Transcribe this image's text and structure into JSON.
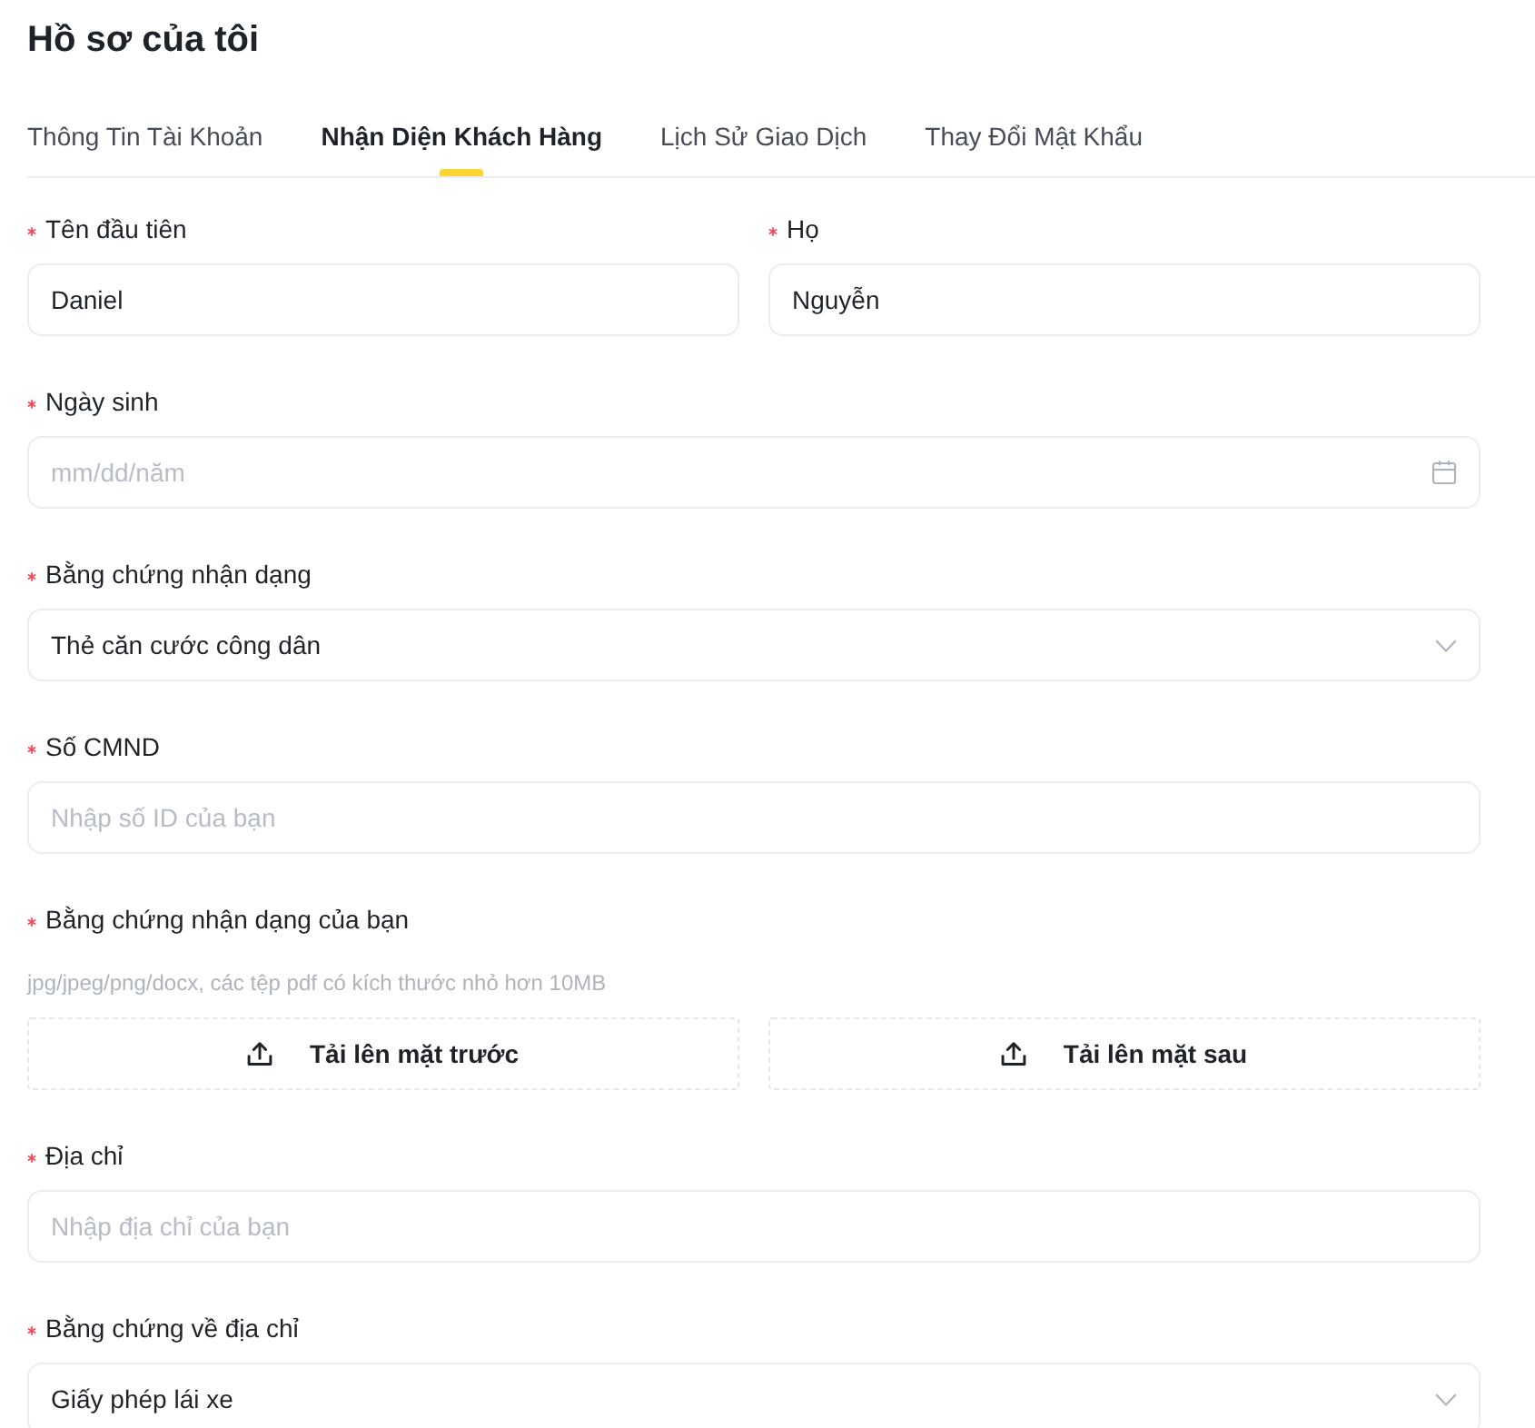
{
  "page": {
    "title": "Hồ sơ của tôi"
  },
  "tabs": [
    {
      "label": "Thông Tin Tài Khoản",
      "selected": false
    },
    {
      "label": "Nhận Diện Khách Hàng",
      "selected": true
    },
    {
      "label": "Lịch Sử Giao Dịch",
      "selected": false
    },
    {
      "label": "Thay Đổi Mật Khẩu",
      "selected": false
    }
  ],
  "form_rows": [
    {
      "fields": [
        {
          "kind": "text",
          "label": "Tên đầu tiên",
          "required": true,
          "value": "Daniel"
        },
        {
          "kind": "text",
          "label": "Họ",
          "required": true,
          "value": "Nguyễn"
        }
      ]
    },
    {
      "fields": [
        {
          "kind": "date",
          "label": "Ngày sinh",
          "required": true,
          "placeholder": "mm/dd/năm"
        }
      ]
    },
    {
      "fields": [
        {
          "kind": "select",
          "label": "Bằng chứng nhận dạng",
          "required": true,
          "value": "Thẻ căn cước công dân"
        }
      ]
    },
    {
      "fields": [
        {
          "kind": "text",
          "label": "Số CMND",
          "required": true,
          "placeholder": "Nhập số ID của bạn"
        }
      ]
    },
    {
      "fields": [
        {
          "kind": "upload",
          "label": "Bằng chứng nhận dạng của bạn",
          "required": true,
          "hint": "jpg/jpeg/png/docx, các tệp pdf có kích thước nhỏ hơn 10MB",
          "buttons": [
            "Tải lên mặt trước",
            "Tải lên mặt sau"
          ]
        }
      ]
    },
    {
      "fields": [
        {
          "kind": "text",
          "label": "Địa chỉ",
          "required": true,
          "placeholder": "Nhập địa chỉ của bạn"
        }
      ]
    },
    {
      "fields": [
        {
          "kind": "select",
          "label": "Bằng chứng về địa chỉ",
          "required": true,
          "value": "Giấy phép lái xe"
        }
      ]
    }
  ]
}
